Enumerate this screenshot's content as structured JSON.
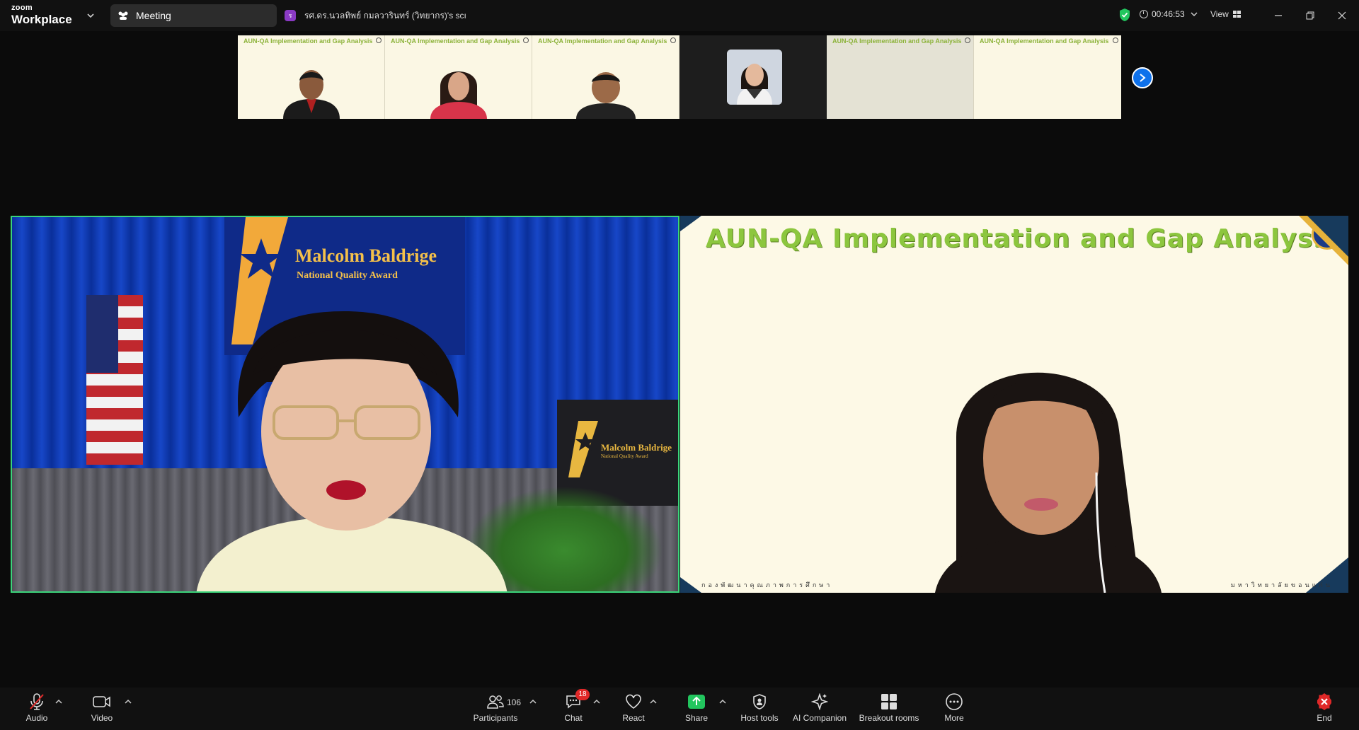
{
  "titlebar": {
    "brand_small": "zoom",
    "brand_large": "Workplace",
    "meeting_tab": "Meeting",
    "share_tab": "รศ.ดร.นวลทิพย์ กมลวารินทร์ (วิทยากร)'s scı",
    "share_tab_badge": "ร",
    "timer": "00:46:53",
    "view_label": "View"
  },
  "thumbnails": [
    {
      "title": "AUN-QA Implementation and Gap Analysis"
    },
    {
      "title": "AUN-QA Implementation and Gap Analysis"
    },
    {
      "title": "AUN-QA Implementation and Gap Analysis"
    },
    {
      "title": ""
    },
    {
      "title": "AUN-QA Implementation and Gap Analysis"
    },
    {
      "title": "AUN-QA Implementation and Gap Analysis"
    }
  ],
  "left_video": {
    "banner_line1": "Malcolm Baldrige",
    "banner_line2": "National Quality Award",
    "podium_line1": "Malcolm Baldrige",
    "podium_line2": "National Quality Award"
  },
  "right_video": {
    "slide_title": "AUN-QA Implementation and Gap Analysis",
    "footer_left": "กองพัฒนาคุณภาพการศึกษา",
    "footer_right": "มหาวิทยาลัยขอนแก่น"
  },
  "toolbar": {
    "audio": "Audio",
    "video": "Video",
    "participants": "Participants",
    "participants_count": "106",
    "chat": "Chat",
    "chat_badge": "18",
    "react": "React",
    "share": "Share",
    "host_tools": "Host tools",
    "ai_companion": "AI Companion",
    "breakout": "Breakout rooms",
    "more": "More",
    "end": "End"
  },
  "colors": {
    "active_speaker_border": "#3bd47a",
    "share_green": "#22c55e",
    "end_red": "#e02828",
    "accent_blue": "#0e71eb",
    "slide_title_green": "#8cc63e"
  }
}
